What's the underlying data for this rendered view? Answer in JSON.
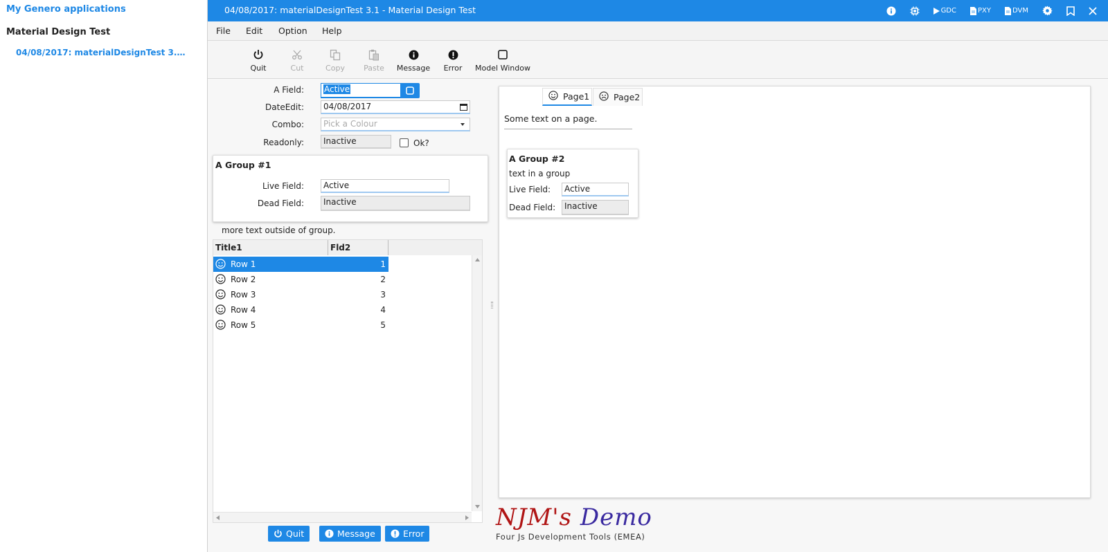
{
  "sidebar": {
    "title": "My Genero applications",
    "app_name": "Material Design Test",
    "session_label": "04/08/2017: materialDesignTest 3.1 - M..."
  },
  "titlebar": {
    "title": "04/08/2017: materialDesignTest 3.1 - Material Design Test",
    "icons": [
      {
        "name": "info-icon",
        "label": ""
      },
      {
        "name": "chip-icon",
        "label": ""
      },
      {
        "name": "play-icon",
        "label": "GDC"
      },
      {
        "name": "document-icon",
        "label": "PXY"
      },
      {
        "name": "document-icon",
        "label": "DVM"
      },
      {
        "name": "gear-icon",
        "label": ""
      },
      {
        "name": "bookmark-icon",
        "label": ""
      },
      {
        "name": "close-icon",
        "label": ""
      }
    ]
  },
  "menubar": {
    "file": "File",
    "edit": "Edit",
    "option": "Option",
    "help": "Help"
  },
  "toolbar": {
    "quit": "Quit",
    "cut": "Cut",
    "copy": "Copy",
    "paste": "Paste",
    "message": "Message",
    "error": "Error",
    "model_window": "Model Window"
  },
  "form": {
    "a_field_label": "A Field:",
    "a_field_value": "Active",
    "dateedit_label": "DateEdit:",
    "dateedit_value": "04/08/2017",
    "combo_label": "Combo:",
    "combo_placeholder": "Pick a Colour",
    "readonly_label": "Readonly:",
    "readonly_value": "Inactive",
    "ok_label": "Ok?",
    "group1": {
      "title": "A Group #1",
      "live_label": "Live Field:",
      "live_value": "Active",
      "dead_label": "Dead Field:",
      "dead_value": "Inactive"
    },
    "outside_text": "more text outside of group."
  },
  "table": {
    "columns": [
      "Title1",
      "Fld2"
    ],
    "rows": [
      {
        "title": "Row 1",
        "value": "1",
        "selected": true
      },
      {
        "title": "Row 2",
        "value": "2",
        "selected": false
      },
      {
        "title": "Row 3",
        "value": "3",
        "selected": false
      },
      {
        "title": "Row 4",
        "value": "4",
        "selected": false
      },
      {
        "title": "Row 5",
        "value": "5",
        "selected": false
      }
    ]
  },
  "buttons": {
    "quit": "Quit",
    "message": "Message",
    "error": "Error"
  },
  "folder": {
    "tabs": [
      {
        "label": "Page1",
        "icon": "smile-icon"
      },
      {
        "label": "Page2",
        "icon": "frown-icon"
      }
    ],
    "page_text": "Some text on a page.",
    "group2": {
      "title": "A Group #2",
      "text": "text in a group",
      "live_label": "Live Field:",
      "live_value": "Active",
      "dead_label": "Dead Field:",
      "dead_value": "Inactive"
    }
  },
  "logo": {
    "main_a": "NJM's",
    "main_b": "Demo",
    "subtitle": "Four Js Development Tools (EMEA)"
  },
  "colors": {
    "accent": "#1e88e5",
    "logo_red": "#b01515",
    "logo_blue": "#3a2aa0"
  }
}
